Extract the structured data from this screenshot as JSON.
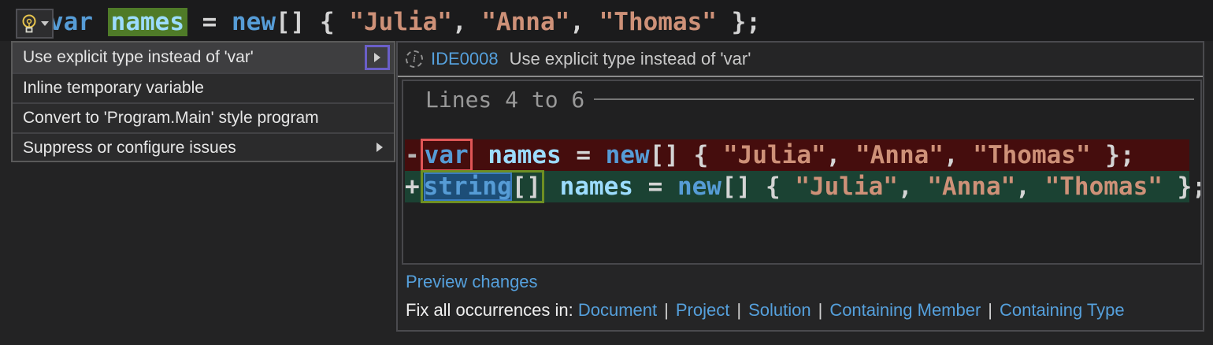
{
  "colors": {
    "accent_link": "#55a0dc",
    "keyword_blue": "#569cd6",
    "variable_blue": "#9cdcfe",
    "string_salmon": "#ce9178",
    "punctuation_gray": "#d4d4d4",
    "removed_line_bg": "#450d0d",
    "added_line_bg": "#1b4233",
    "symbol_highlight_green": "#4f7b28",
    "selection_blue": "#1d4e78",
    "removed_box_border": "#e05656",
    "added_box_border": "#6e8f23",
    "submenu_focus_border": "#6a5fc8"
  },
  "code": {
    "kw_var": "var",
    "kw_string": "string",
    "kw_new": "new",
    "name": "names",
    "space": " ",
    "eq": " = ",
    "brackets": "[]",
    "open_brace": " { ",
    "str_julia": "\"Julia\"",
    "str_anna": "\"Anna\"",
    "str_thomas": "\"Thomas\"",
    "comma": ", ",
    "close": " };",
    "removed_prefix": "-",
    "added_prefix": "+"
  },
  "lightbulb_menu": {
    "items": [
      {
        "label": "Use explicit type instead of 'var'",
        "highlighted": true,
        "has_submenu": true
      },
      {
        "label": "Inline temporary variable",
        "highlighted": false,
        "has_submenu": false
      },
      {
        "label": "Convert to 'Program.Main' style program",
        "highlighted": false,
        "has_submenu": false
      },
      {
        "label": "Suppress or configure issues",
        "highlighted": false,
        "has_submenu": true
      }
    ]
  },
  "preview_panel": {
    "rule_id": "IDE0008",
    "title": "Use explicit type instead of 'var'",
    "lines_label": "Lines 4 to 6",
    "preview_changes": "Preview changes",
    "fix_all_label": "Fix all occurrences in:",
    "fix_all_separator": "|",
    "fix_all_links": [
      {
        "label": "Document"
      },
      {
        "label": "Project"
      },
      {
        "label": "Solution"
      },
      {
        "label": "Containing Member"
      },
      {
        "label": "Containing Type"
      }
    ]
  }
}
